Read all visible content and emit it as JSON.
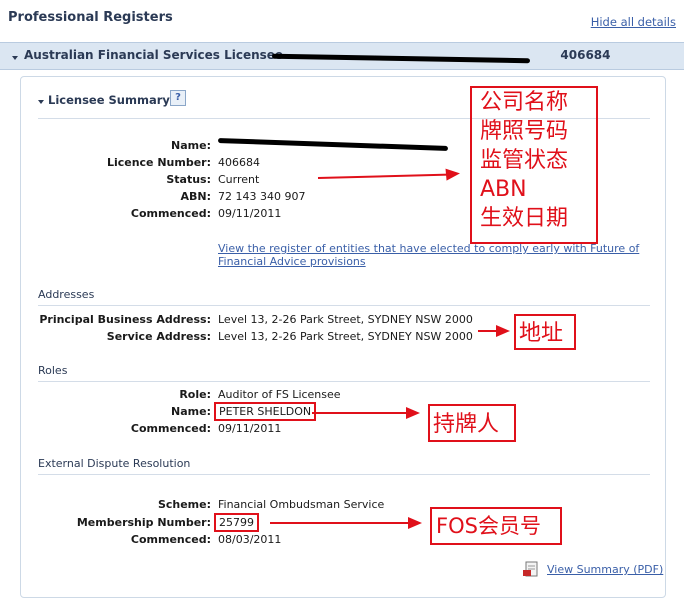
{
  "header": {
    "title": "Professional Registers",
    "hide_all": "Hide all details"
  },
  "section": {
    "title": "Australian Financial Services Licensee - ",
    "title_suffix": "406684"
  },
  "licensee_summary": {
    "heading": "Licensee Summary",
    "rows": [
      {
        "label": "Name:",
        "value": ""
      },
      {
        "label": "Licence Number:",
        "value": "406684"
      },
      {
        "label": "Status:",
        "value": "Current"
      },
      {
        "label": "ABN:",
        "value": "72 143 340 907"
      },
      {
        "label": "Commenced:",
        "value": "09/11/2011"
      }
    ],
    "fofa_link": "View the register of entities that have elected to comply early with Future of",
    "fofa_link_line2": "Financial Advice provisions"
  },
  "addresses": {
    "heading": "Addresses",
    "rows": [
      {
        "label": "Principal Business Address:",
        "value": "Level 13, 2-26 Park Street, SYDNEY NSW 2000"
      },
      {
        "label": "Service Address:",
        "value": "Level 13, 2-26 Park Street, SYDNEY NSW 2000"
      }
    ]
  },
  "roles": {
    "heading": "Roles",
    "rows": [
      {
        "label": "Role:",
        "value": "Auditor of FS Licensee"
      },
      {
        "label": "Name:",
        "value": "PETER SHELDON"
      },
      {
        "label": "Commenced:",
        "value": "09/11/2011"
      }
    ]
  },
  "edr": {
    "heading": "External Dispute Resolution",
    "rows": [
      {
        "label": "Scheme:",
        "value": "Financial Ombudsman Service"
      },
      {
        "label": "Membership Number:",
        "value": "25799"
      },
      {
        "label": "Commenced:",
        "value": "08/03/2011"
      }
    ]
  },
  "view_summary": "View Summary (PDF)",
  "annotations": {
    "summary_lines": [
      "公司名称",
      "牌照号码",
      "监管状态",
      "ABN",
      "生效日期"
    ],
    "address": "地址",
    "holder": "持牌人",
    "fos": "FOS会员号"
  },
  "colors": {
    "annotation_red": "#e0101a",
    "link_blue": "#3a5fa8",
    "header_bar": "#dbe6f2"
  }
}
